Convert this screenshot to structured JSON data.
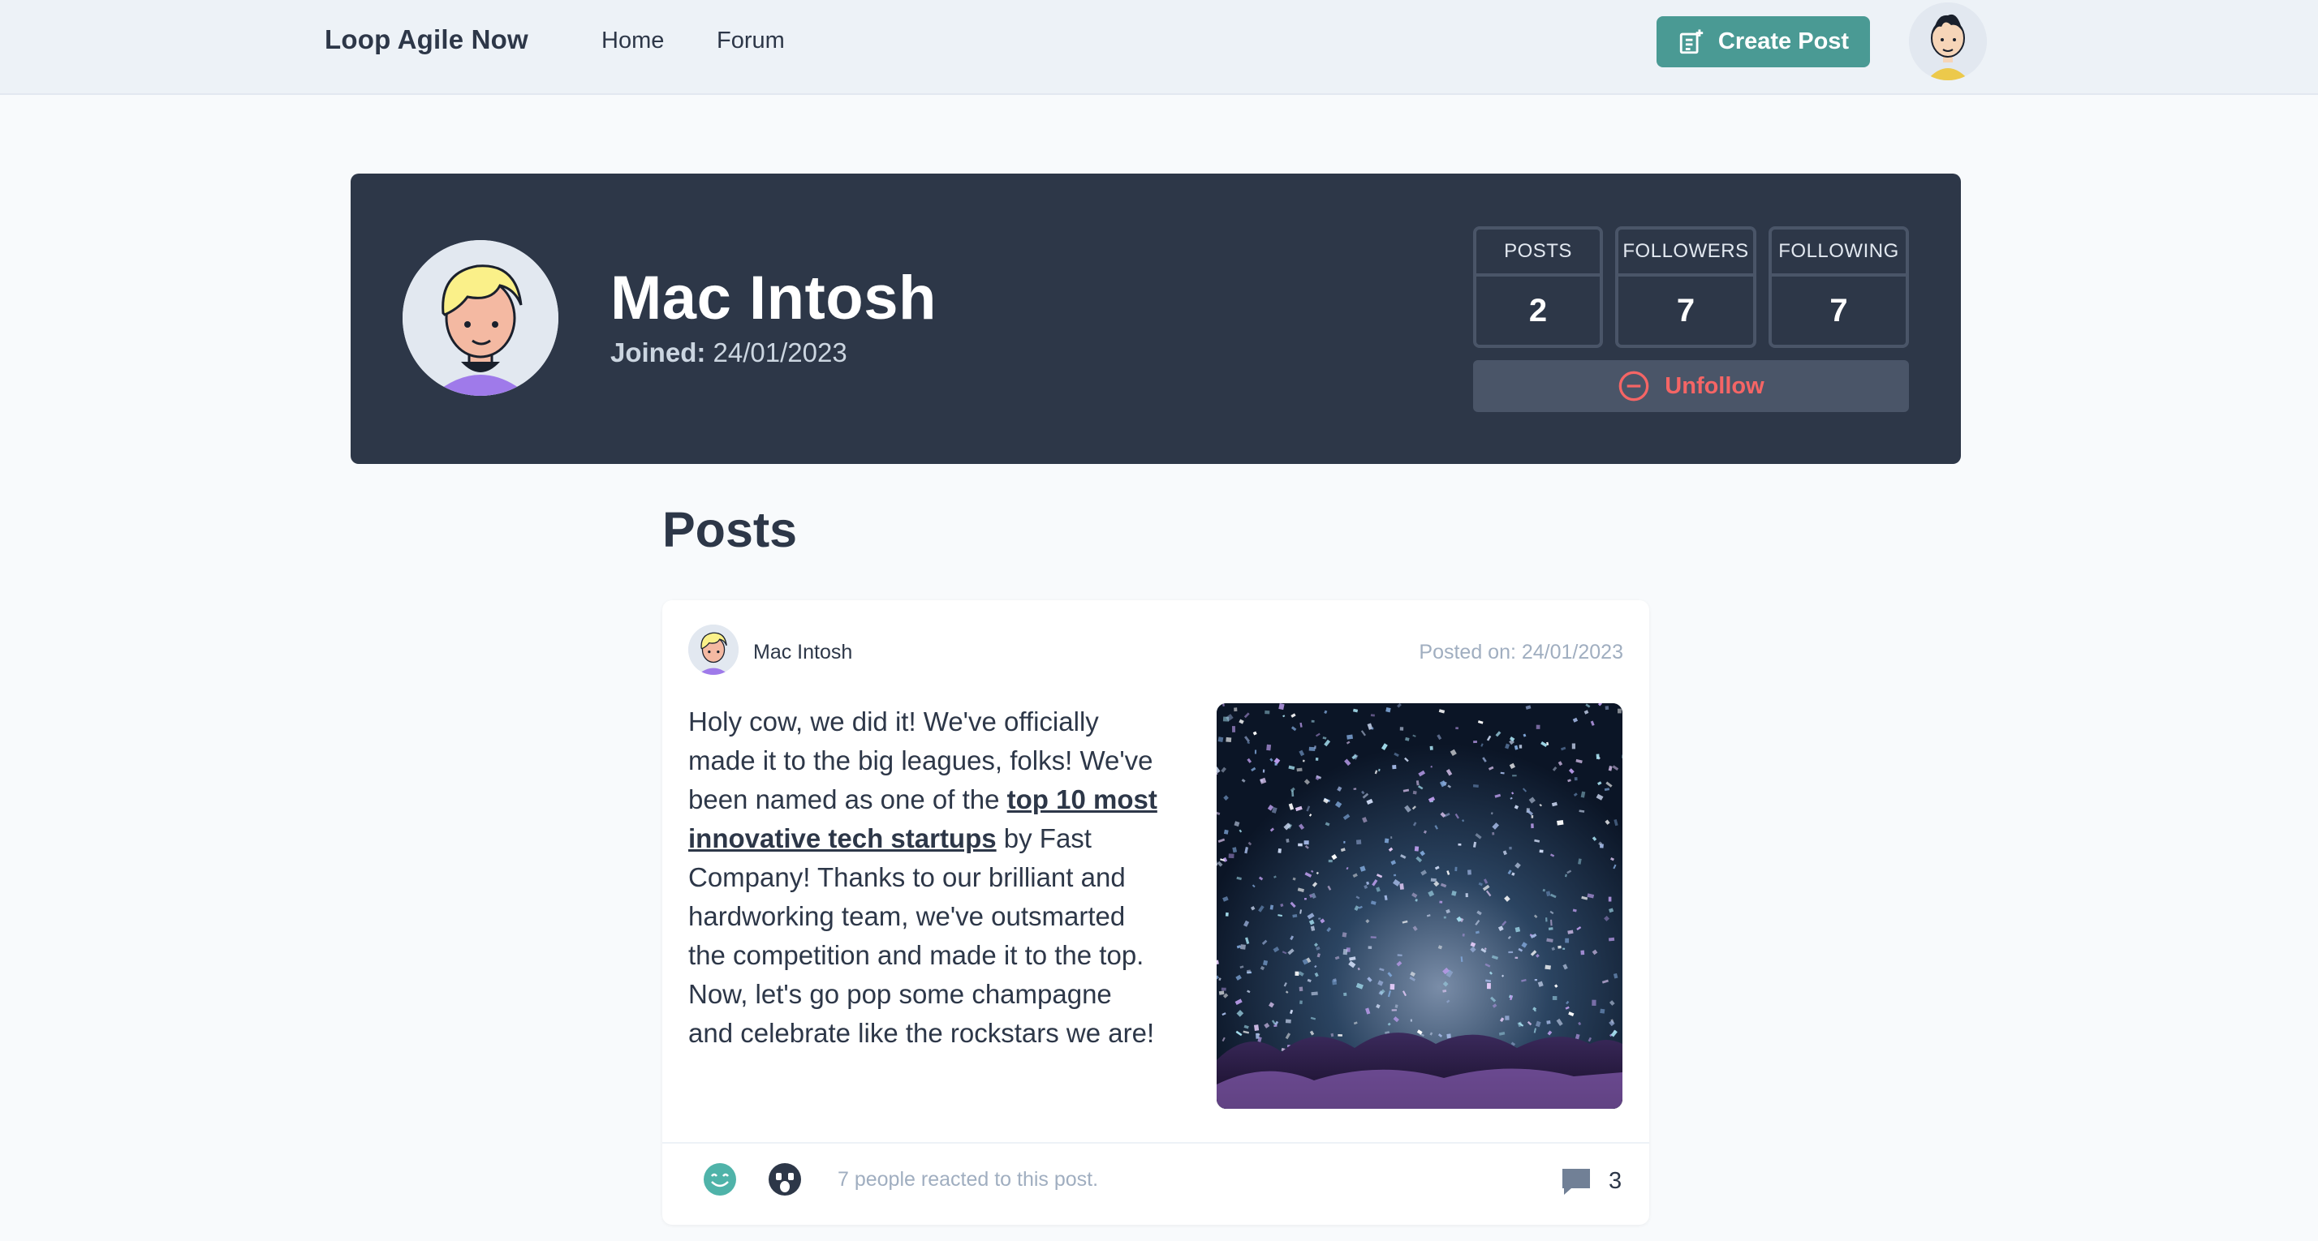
{
  "navbar": {
    "brand": "Loop Agile Now",
    "links": [
      "Home",
      "Forum"
    ],
    "create_post_label": "Create Post",
    "avatar_icon": "user-avatar-icon"
  },
  "profile": {
    "name": "Mac Intosh",
    "joined_label": "Joined:",
    "joined_date": "24/01/2023",
    "stats": [
      {
        "label": "POSTS",
        "value": "2"
      },
      {
        "label": "FOLLOWERS",
        "value": "7"
      },
      {
        "label": "FOLLOWING",
        "value": "7"
      }
    ],
    "unfollow_label": "Unfollow",
    "colors": {
      "banner": "#2d3748",
      "unfollow": "#f56565",
      "accent": "#4a9a94"
    }
  },
  "posts_heading": "Posts",
  "post": {
    "author": "Mac Intosh",
    "posted_on": "Posted on: 24/01/2023",
    "text_before": "Holy cow, we did it! We've officially made it to the big leagues, folks! We've been named as one of the ",
    "link_text": "top 10 most innovative tech startups",
    "text_after": " by Fast Company! Thanks to our brilliant and hardworking team, we've outsmarted the competition and made it to the top. Now, let's go pop some champagne and celebrate like the rockstars we are!",
    "reactions_text": "7 people reacted to this post.",
    "comment_count": "3",
    "reaction_icons": [
      "smile-reaction-icon",
      "shocked-reaction-icon"
    ]
  }
}
